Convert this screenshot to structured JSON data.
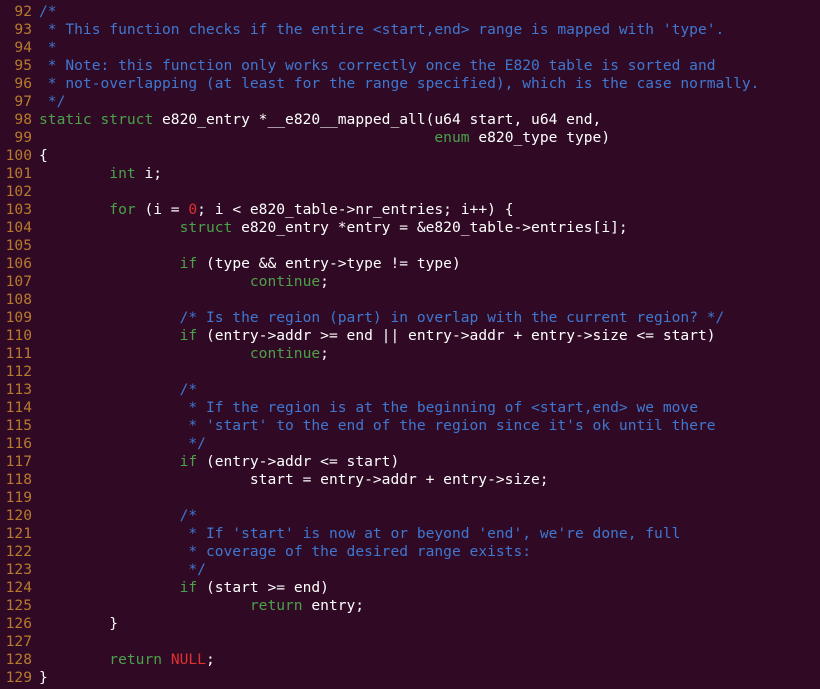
{
  "editor": {
    "lines": [
      {
        "num": "92",
        "tokens": [
          {
            "t": "comment",
            "v": "/*"
          }
        ]
      },
      {
        "num": "93",
        "tokens": [
          {
            "t": "comment",
            "v": " * This function checks if the entire <start,end> range is mapped with 'type'."
          }
        ]
      },
      {
        "num": "94",
        "tokens": [
          {
            "t": "comment",
            "v": " *"
          }
        ]
      },
      {
        "num": "95",
        "tokens": [
          {
            "t": "comment",
            "v": " * Note: this function only works correctly once the E820 table is sorted and"
          }
        ]
      },
      {
        "num": "96",
        "tokens": [
          {
            "t": "comment",
            "v": " * not-overlapping (at least for the range specified), which is the case normally."
          }
        ]
      },
      {
        "num": "97",
        "tokens": [
          {
            "t": "comment",
            "v": " */"
          }
        ]
      },
      {
        "num": "98",
        "tokens": [
          {
            "t": "kw",
            "v": "static"
          },
          {
            "t": "plain",
            "v": " "
          },
          {
            "t": "kw",
            "v": "struct"
          },
          {
            "t": "plain",
            "v": " e820_entry *__e820__mapped_all(u64 start, u64 end,"
          }
        ]
      },
      {
        "num": "99",
        "tokens": [
          {
            "t": "plain",
            "v": "                                             "
          },
          {
            "t": "kw",
            "v": "enum"
          },
          {
            "t": "plain",
            "v": " e820_type type)"
          }
        ]
      },
      {
        "num": "100",
        "tokens": [
          {
            "t": "plain",
            "v": "{"
          }
        ]
      },
      {
        "num": "101",
        "tokens": [
          {
            "t": "plain",
            "v": "        "
          },
          {
            "t": "type",
            "v": "int"
          },
          {
            "t": "plain",
            "v": " i;"
          }
        ]
      },
      {
        "num": "102",
        "tokens": []
      },
      {
        "num": "103",
        "tokens": [
          {
            "t": "plain",
            "v": "        "
          },
          {
            "t": "kw",
            "v": "for"
          },
          {
            "t": "plain",
            "v": " (i = "
          },
          {
            "t": "number",
            "v": "0"
          },
          {
            "t": "plain",
            "v": "; i < e820_table->nr_entries; i++) {"
          }
        ]
      },
      {
        "num": "104",
        "tokens": [
          {
            "t": "plain",
            "v": "                "
          },
          {
            "t": "kw",
            "v": "struct"
          },
          {
            "t": "plain",
            "v": " e820_entry *entry = &e820_table->entries[i];"
          }
        ]
      },
      {
        "num": "105",
        "tokens": []
      },
      {
        "num": "106",
        "tokens": [
          {
            "t": "plain",
            "v": "                "
          },
          {
            "t": "kw",
            "v": "if"
          },
          {
            "t": "plain",
            "v": " (type && entry->type != type)"
          }
        ]
      },
      {
        "num": "107",
        "tokens": [
          {
            "t": "plain",
            "v": "                        "
          },
          {
            "t": "kw",
            "v": "continue"
          },
          {
            "t": "plain",
            "v": ";"
          }
        ]
      },
      {
        "num": "108",
        "tokens": []
      },
      {
        "num": "109",
        "tokens": [
          {
            "t": "plain",
            "v": "                "
          },
          {
            "t": "comment",
            "v": "/* Is the region (part) in overlap with the current region? */"
          }
        ]
      },
      {
        "num": "110",
        "tokens": [
          {
            "t": "plain",
            "v": "                "
          },
          {
            "t": "kw",
            "v": "if"
          },
          {
            "t": "plain",
            "v": " (entry->addr >= end || entry->addr + entry->size <= start)"
          }
        ]
      },
      {
        "num": "111",
        "tokens": [
          {
            "t": "plain",
            "v": "                        "
          },
          {
            "t": "kw",
            "v": "continue"
          },
          {
            "t": "plain",
            "v": ";"
          }
        ]
      },
      {
        "num": "112",
        "tokens": []
      },
      {
        "num": "113",
        "tokens": [
          {
            "t": "plain",
            "v": "                "
          },
          {
            "t": "comment",
            "v": "/*"
          }
        ]
      },
      {
        "num": "114",
        "tokens": [
          {
            "t": "plain",
            "v": "                "
          },
          {
            "t": "comment",
            "v": " * If the region is at the beginning of <start,end> we move"
          }
        ]
      },
      {
        "num": "115",
        "tokens": [
          {
            "t": "plain",
            "v": "                "
          },
          {
            "t": "comment",
            "v": " * 'start' to the end of the region since it's ok until there"
          }
        ]
      },
      {
        "num": "116",
        "tokens": [
          {
            "t": "plain",
            "v": "                "
          },
          {
            "t": "comment",
            "v": " */"
          }
        ]
      },
      {
        "num": "117",
        "tokens": [
          {
            "t": "plain",
            "v": "                "
          },
          {
            "t": "kw",
            "v": "if"
          },
          {
            "t": "plain",
            "v": " (entry->addr <= start)"
          }
        ]
      },
      {
        "num": "118",
        "tokens": [
          {
            "t": "plain",
            "v": "                        start = entry->addr + entry->size;"
          }
        ]
      },
      {
        "num": "119",
        "tokens": []
      },
      {
        "num": "120",
        "tokens": [
          {
            "t": "plain",
            "v": "                "
          },
          {
            "t": "comment",
            "v": "/*"
          }
        ]
      },
      {
        "num": "121",
        "tokens": [
          {
            "t": "plain",
            "v": "                "
          },
          {
            "t": "comment",
            "v": " * If 'start' is now at or beyond 'end', we're done, full"
          }
        ]
      },
      {
        "num": "122",
        "tokens": [
          {
            "t": "plain",
            "v": "                "
          },
          {
            "t": "comment",
            "v": " * coverage of the desired range exists:"
          }
        ]
      },
      {
        "num": "123",
        "tokens": [
          {
            "t": "plain",
            "v": "                "
          },
          {
            "t": "comment",
            "v": " */"
          }
        ]
      },
      {
        "num": "124",
        "tokens": [
          {
            "t": "plain",
            "v": "                "
          },
          {
            "t": "kw",
            "v": "if"
          },
          {
            "t": "plain",
            "v": " (start >= end)"
          }
        ]
      },
      {
        "num": "125",
        "tokens": [
          {
            "t": "plain",
            "v": "                        "
          },
          {
            "t": "kw",
            "v": "return"
          },
          {
            "t": "plain",
            "v": " entry;"
          }
        ]
      },
      {
        "num": "126",
        "tokens": [
          {
            "t": "plain",
            "v": "        }"
          }
        ]
      },
      {
        "num": "127",
        "tokens": []
      },
      {
        "num": "128",
        "tokens": [
          {
            "t": "plain",
            "v": "        "
          },
          {
            "t": "kw",
            "v": "return"
          },
          {
            "t": "plain",
            "v": " "
          },
          {
            "t": "macro",
            "v": "NULL"
          },
          {
            "t": "plain",
            "v": ";"
          }
        ]
      },
      {
        "num": "129",
        "tokens": [
          {
            "t": "plain",
            "v": "}"
          }
        ]
      }
    ]
  },
  "colors": {
    "background": "#300a24",
    "line_number": "#b87a2e",
    "comment": "#3f77d1",
    "keyword": "#4aa14a",
    "number": "#e03030",
    "text": "#ffffff"
  }
}
